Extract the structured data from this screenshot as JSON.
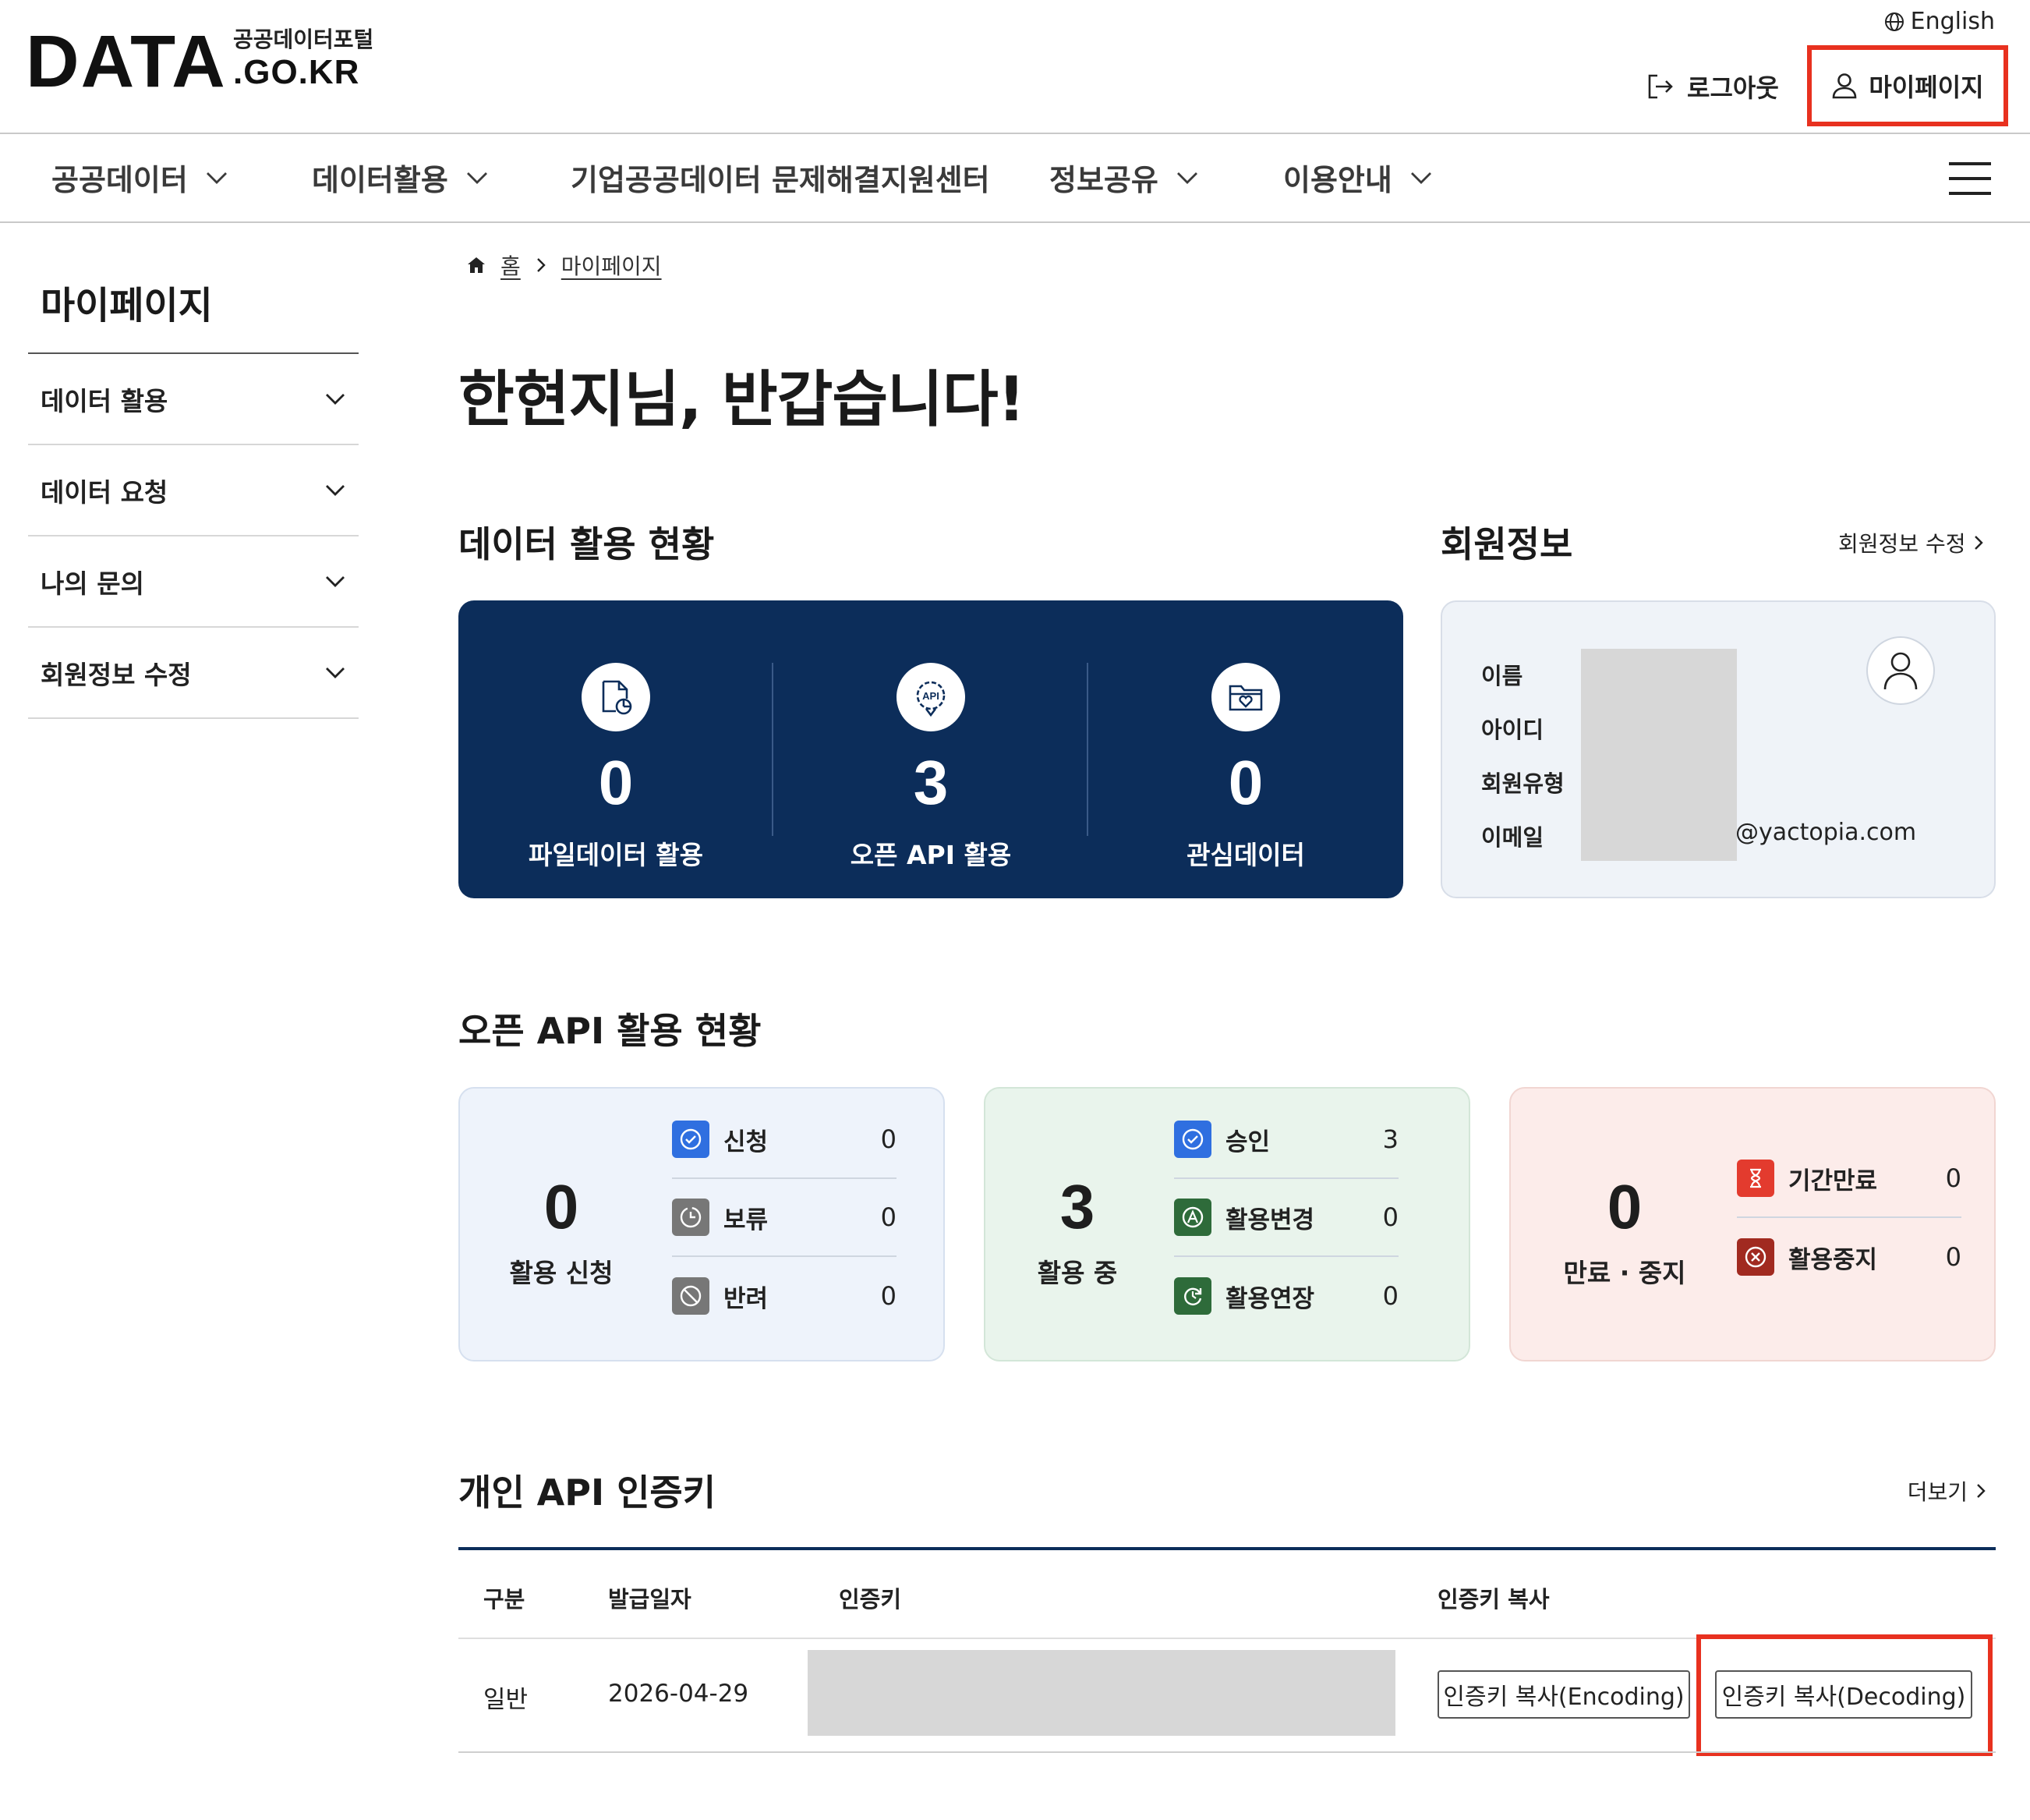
{
  "header": {
    "logo_text": "DATA",
    "logo_subtitle": "공공데이터포털",
    "logo_domain": ".GO.KR",
    "language": "English",
    "logout": "로그아웃",
    "mypage": "마이페이지"
  },
  "gnb": {
    "items": [
      {
        "label": "공공데이터",
        "has_dropdown": true
      },
      {
        "label": "데이터활용",
        "has_dropdown": true
      },
      {
        "label": "기업공공데이터 문제해결지원센터",
        "has_dropdown": false
      },
      {
        "label": "정보공유",
        "has_dropdown": true
      },
      {
        "label": "이용안내",
        "has_dropdown": true
      }
    ]
  },
  "sidebar": {
    "title": "마이페이지",
    "items": [
      {
        "label": "데이터 활용"
      },
      {
        "label": "데이터 요청"
      },
      {
        "label": "나의 문의"
      },
      {
        "label": "회원정보 수정"
      }
    ]
  },
  "breadcrumb": {
    "home": "홈",
    "current": "마이페이지"
  },
  "welcome": "한현지님, 반갑습니다!",
  "data_usage": {
    "title": "데이터 활용 현황",
    "stats": [
      {
        "value": "0",
        "label": "파일데이터 활용",
        "icon": "file-chart-icon"
      },
      {
        "value": "3",
        "label": "오픈 API 활용",
        "icon": "api-gear-icon"
      },
      {
        "value": "0",
        "label": "관심데이터",
        "icon": "folder-heart-icon"
      }
    ]
  },
  "member": {
    "title": "회원정보",
    "edit_link": "회원정보 수정",
    "labels": [
      "이름",
      "아이디",
      "회원유형",
      "이메일"
    ],
    "email_visible": "@yactopia.com"
  },
  "api_status": {
    "title": "오픈 API 활용 현황",
    "cards": [
      {
        "value": "0",
        "label": "활용 신청",
        "rows": [
          {
            "label": "신청",
            "value": "0",
            "icon": "check-circle-icon"
          },
          {
            "label": "보류",
            "value": "0",
            "icon": "clock-icon"
          },
          {
            "label": "반려",
            "value": "0",
            "icon": "ban-icon"
          }
        ]
      },
      {
        "value": "3",
        "label": "활용 중",
        "rows": [
          {
            "label": "승인",
            "value": "3",
            "icon": "check-circle-icon"
          },
          {
            "label": "활용변경",
            "value": "0",
            "icon": "change-icon"
          },
          {
            "label": "활용연장",
            "value": "0",
            "icon": "extend-icon"
          }
        ]
      },
      {
        "value": "0",
        "label": "만료 · 중지",
        "rows": [
          {
            "label": "기간만료",
            "value": "0",
            "icon": "hourglass-icon"
          },
          {
            "label": "활용중지",
            "value": "0",
            "icon": "x-circle-icon"
          }
        ]
      }
    ]
  },
  "api_keys": {
    "title": "개인 API 인증키",
    "more": "더보기",
    "headers": [
      "구분",
      "발급일자",
      "인증키",
      "인증키 복사"
    ],
    "rows": [
      {
        "type": "일반",
        "issued": "2026-04-29",
        "copy_encoding": "인증키 복사(Encoding)",
        "copy_decoding": "인증키 복사(Decoding)"
      }
    ]
  },
  "colors": {
    "navy": "#0c2d5a",
    "highlight": "#e8311f",
    "card_blue_bg": "#eef3fb",
    "card_green_bg": "#e9f4ec",
    "card_red_bg": "#fcecea",
    "icon_blue": "#2f6fe0",
    "icon_gray": "#777777",
    "icon_green": "#2e6b3a",
    "icon_red": "#e33b2e",
    "icon_darkred": "#a12a20"
  }
}
